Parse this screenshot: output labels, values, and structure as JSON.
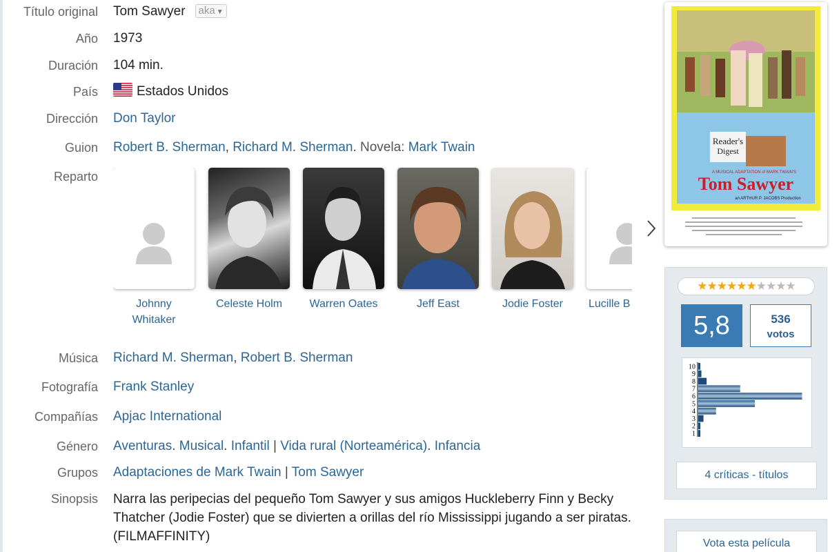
{
  "details": {
    "original_title": {
      "label": "Título original",
      "value": "Tom Sawyer",
      "aka": "aka"
    },
    "year": {
      "label": "Año",
      "value": "1973"
    },
    "duration": {
      "label": "Duración",
      "value": "104 min."
    },
    "country": {
      "label": "País",
      "value": "Estados Unidos"
    },
    "director": {
      "label": "Dirección",
      "value": "Don Taylor"
    },
    "screenplay": {
      "label": "Guion",
      "writer1": "Robert B. Sherman",
      "writer2": "Richard M. Sherman",
      "novel_prefix": "Novela:",
      "novel_author": "Mark Twain"
    },
    "cast_label": "Reparto",
    "music": {
      "label": "Música",
      "composer1": "Richard M. Sherman",
      "composer2": "Robert B. Sherman"
    },
    "photography": {
      "label": "Fotografía",
      "value": "Frank Stanley"
    },
    "companies": {
      "label": "Compañías",
      "value": "Apjac International"
    },
    "genre": {
      "label": "Género",
      "g1": "Aventuras",
      "g2": "Musical",
      "g3": "Infantil",
      "t1": "Vida rural (Norteamérica)",
      "t2": "Infancia"
    },
    "groups": {
      "label": "Grupos",
      "g1": "Adaptaciones de Mark Twain",
      "g2": "Tom Sawyer"
    },
    "synopsis": {
      "label": "Sinopsis",
      "text": "Narra las peripecias del pequeño Tom Sawyer y sus amigos Huckleberry Finn y Becky Thatcher (Jodie Foster) que se divierten a orillas del río Mississippi jugando a ser piratas. (FILMAFFINITY)"
    }
  },
  "cast": [
    {
      "name": "Johnny Whitaker"
    },
    {
      "name": "Celeste Holm"
    },
    {
      "name": "Warren Oates"
    },
    {
      "name": "Jeff East"
    },
    {
      "name": "Jodie Foster"
    },
    {
      "name": "Lucille B"
    }
  ],
  "poster": {
    "line1": "Reader's",
    "line2": "Digest",
    "tag": "A MUSICAL ADAPTATION of MARK TWAIN'S",
    "title": "Tom Sawyer",
    "prod": "an ARTHUR P. JACOBS Production"
  },
  "rating": {
    "average": "5,8",
    "votes": "536",
    "votes_label": "votos",
    "stars_filled": 6,
    "stars_total": 10,
    "histogram": {
      "scores": [
        10,
        9,
        8,
        7,
        6,
        5,
        4,
        3,
        2,
        1
      ],
      "relative": [
        0.02,
        0.03,
        0.08,
        0.4,
        0.99,
        0.54,
        0.17,
        0.05,
        0.02,
        0.02
      ]
    },
    "critics_link": "4 críticas - títulos",
    "vote_button": "Vota esta película"
  },
  "colors": {
    "link": "#2c6696",
    "rating_blue": "#3a7bb6",
    "star": "#f0a90e"
  },
  "icons": {
    "next": "chevron-right-icon",
    "flag": "us-flag-icon",
    "aka": "caret-down-icon"
  }
}
